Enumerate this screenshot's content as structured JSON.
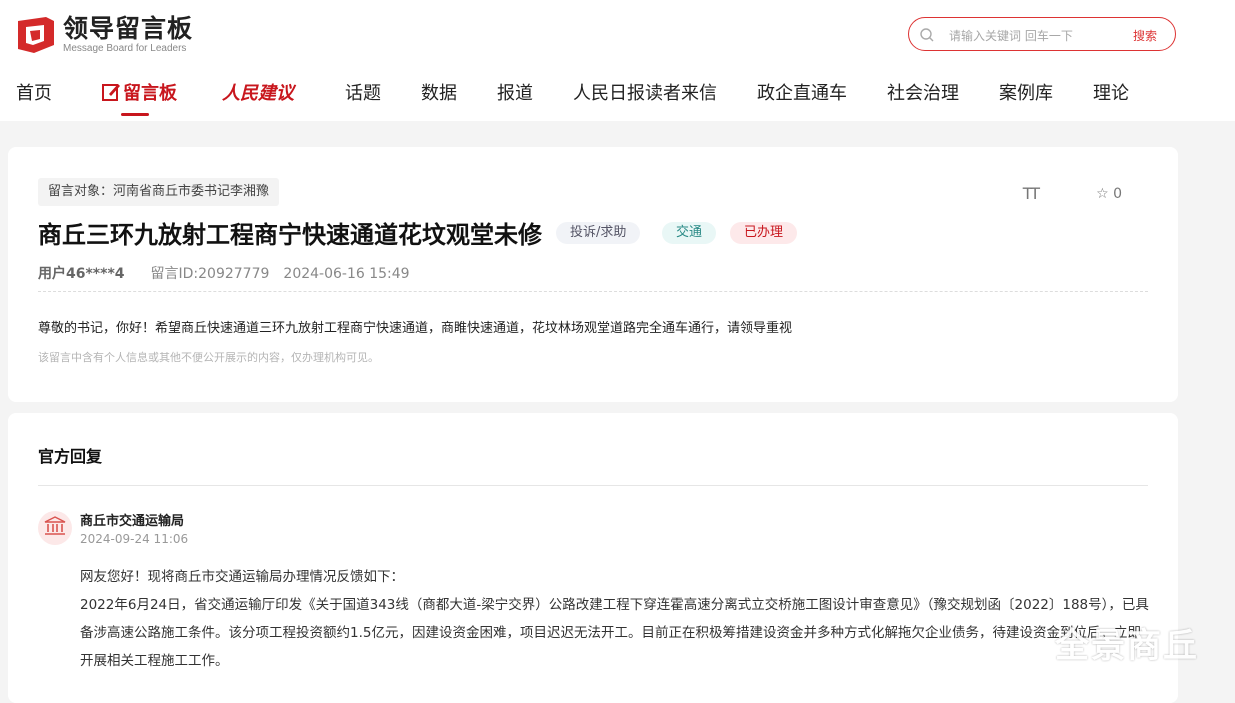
{
  "header": {
    "logo_title": "领导留言板",
    "logo_subtitle": "Message Board for Leaders",
    "search_placeholder": "请输入关键词 回车一下",
    "search_button": "搜索"
  },
  "nav": {
    "items": [
      "首页",
      "留言板",
      "人民建议",
      "话题",
      "数据",
      "报道",
      "人民日报读者来信",
      "政企直通车",
      "社会治理",
      "案例库",
      "理论"
    ],
    "active_index": 1
  },
  "message": {
    "target": "留言对象：河南省商丘市委书记李湘豫",
    "font_tool": "TT",
    "star_count": "0",
    "title": "商丘三环九放射工程商宁快速通道花坟观堂未修",
    "tags": [
      "投诉/求助",
      "交通",
      "已办理"
    ],
    "user": "用户46****4",
    "message_id": "留言ID:20927779",
    "datetime": "2024-06-16 15:49",
    "content": "尊敬的书记，你好！希望商丘快速通道三环九放射工程商宁快速通道，商睢快速通道，花坟林场观堂道路完全通车通行，请领导重视",
    "notice": "该留言中含有个人信息或其他不便公开展示的内容，仅办理机构可见。"
  },
  "reply": {
    "heading": "官方回复",
    "org": "商丘市交通运输局",
    "date": "2024-09-24 11:06",
    "greeting": "网友您好！现将商丘市交通运输局办理情况反馈如下：",
    "body": "2022年6月24日，省交通运输厅印发《关于国道343线（商都大道-梁宁交界）公路改建工程下穿连霍高速分离式立交桥施工图设计审查意见》（豫交规划函〔2022〕188号），已具备涉高速公路施工条件。该分项工程投资额约1.5亿元，因建设资金困难，项目迟迟无法开工。目前正在积极筹措建设资金并多种方式化解拖欠企业债务，待建设资金到位后，立即开展相关工程施工工作。"
  },
  "watermark": "全景商丘",
  "colors": {
    "brand_red": "#c8161d",
    "tag_teal": "#2a8a86",
    "background": "#f4f4f4"
  }
}
